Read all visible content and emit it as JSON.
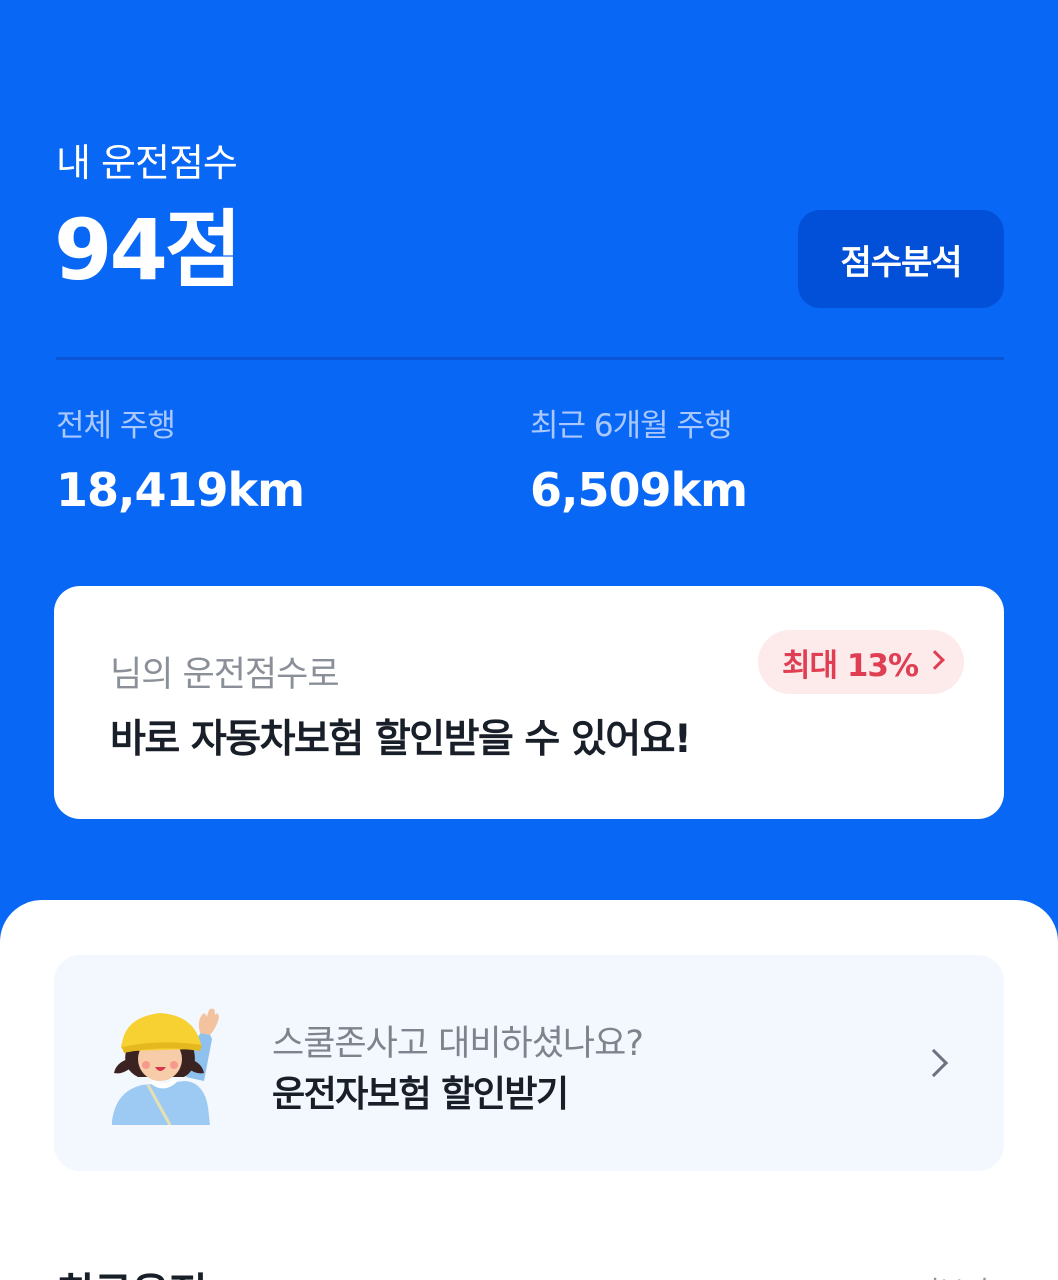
{
  "header": {
    "title": "내 운전점수",
    "score": "94점",
    "analyze_button": "점수분석"
  },
  "stats": {
    "total": {
      "label": "전체 주행",
      "value": "18,419km"
    },
    "recent": {
      "label": "최근 6개월 주행",
      "value": "6,509km"
    }
  },
  "insurance_card": {
    "subtitle": "님의 운전점수로",
    "title": "바로 자동차보험 할인받을 수 있어요!",
    "badge": "최대 13%"
  },
  "school_zone_card": {
    "subtitle": "스쿨존사고 대비하셨나요?",
    "title": "운전자보험 할인받기",
    "icon": "girl-waving-illustration"
  },
  "recent_section": {
    "title": "최근운전",
    "more_label": "더보기"
  }
}
